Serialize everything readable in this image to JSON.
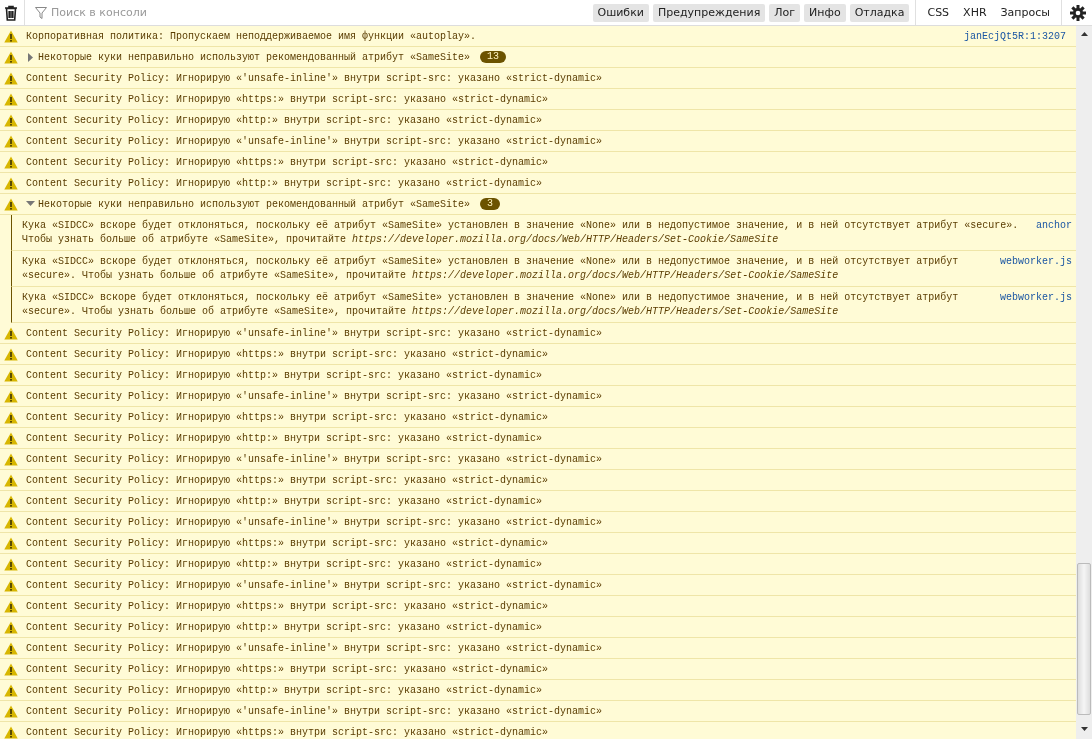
{
  "toolbar": {
    "search": {
      "placeholder": "Поиск в консоли"
    },
    "filters": [
      {
        "label": "Ошибки",
        "selected": true
      },
      {
        "label": "Предупреждения",
        "selected": true
      },
      {
        "label": "Лог",
        "selected": true
      },
      {
        "label": "Инфо",
        "selected": true
      },
      {
        "label": "Отладка",
        "selected": true
      }
    ],
    "request_filters": [
      {
        "label": "CSS",
        "selected": false
      },
      {
        "label": "XHR",
        "selected": false
      },
      {
        "label": "Запросы",
        "selected": false
      }
    ]
  },
  "messages": [
    {
      "kind": "warning",
      "text": "Корпоративная политика: Пропускаем неподдерживаемое имя функции «autoplay».",
      "source": "janEcjQt5R:1:3207"
    },
    {
      "kind": "group",
      "text": "Некоторые куки неправильно используют рекомендованный атрибут «SameSite»",
      "count": "13",
      "expanded": false
    },
    {
      "kind": "warning",
      "text": "Content Security Policy: Игнорирую «'unsafe-inline'» внутри script-src: указано «strict-dynamic»"
    },
    {
      "kind": "warning",
      "text": "Content Security Policy: Игнорирую «https:» внутри script-src: указано «strict-dynamic»"
    },
    {
      "kind": "warning",
      "text": "Content Security Policy: Игнорирую «http:» внутри script-src: указано «strict-dynamic»"
    },
    {
      "kind": "warning",
      "text": "Content Security Policy: Игнорирую «'unsafe-inline'» внутри script-src: указано «strict-dynamic»"
    },
    {
      "kind": "warning",
      "text": "Content Security Policy: Игнорирую «https:» внутри script-src: указано «strict-dynamic»"
    },
    {
      "kind": "warning",
      "text": "Content Security Policy: Игнорирую «http:» внутри script-src: указано «strict-dynamic»"
    },
    {
      "kind": "group",
      "text": "Некоторые куки неправильно используют рекомендованный атрибут «SameSite»",
      "count": "3",
      "expanded": true,
      "children": [
        {
          "text": "Кука «SIDCC» вскоре будет отклоняться, поскольку её атрибут «SameSite» установлен в значение «None» или в недопустимое значение, и в ней отсутствует атрибут «secure». Чтобы узнать больше об атрибуте «SameSite», прочитайте *https://developer.mozilla.org/docs/Web/HTTP/Headers/Set-Cookie/SameSite*",
          "source": "anchor"
        },
        {
          "text": "Кука «SIDCC» вскоре будет отклоняться, поскольку её атрибут «SameSite» установлен в значение «None» или в недопустимое значение, и в ней отсутствует атрибут «secure». Чтобы узнать больше об атрибуте «SameSite», прочитайте *https://developer.mozilla.org/docs/Web/HTTP/Headers/Set-Cookie/SameSite*",
          "source": "webworker.js"
        },
        {
          "text": "Кука «SIDCC» вскоре будет отклоняться, поскольку её атрибут «SameSite» установлен в значение «None» или в недопустимое значение, и в ней отсутствует атрибут «secure». Чтобы узнать больше об атрибуте «SameSite», прочитайте *https://developer.mozilla.org/docs/Web/HTTP/Headers/Set-Cookie/SameSite*",
          "source": "webworker.js"
        }
      ]
    },
    {
      "kind": "warning",
      "text": "Content Security Policy: Игнорирую «'unsafe-inline'» внутри script-src: указано «strict-dynamic»"
    },
    {
      "kind": "warning",
      "text": "Content Security Policy: Игнорирую «https:» внутри script-src: указано «strict-dynamic»"
    },
    {
      "kind": "warning",
      "text": "Content Security Policy: Игнорирую «http:» внутри script-src: указано «strict-dynamic»"
    },
    {
      "kind": "warning",
      "text": "Content Security Policy: Игнорирую «'unsafe-inline'» внутри script-src: указано «strict-dynamic»"
    },
    {
      "kind": "warning",
      "text": "Content Security Policy: Игнорирую «https:» внутри script-src: указано «strict-dynamic»"
    },
    {
      "kind": "warning",
      "text": "Content Security Policy: Игнорирую «http:» внутри script-src: указано «strict-dynamic»"
    },
    {
      "kind": "warning",
      "text": "Content Security Policy: Игнорирую «'unsafe-inline'» внутри script-src: указано «strict-dynamic»"
    },
    {
      "kind": "warning",
      "text": "Content Security Policy: Игнорирую «https:» внутри script-src: указано «strict-dynamic»"
    },
    {
      "kind": "warning",
      "text": "Content Security Policy: Игнорирую «http:» внутри script-src: указано «strict-dynamic»"
    },
    {
      "kind": "warning",
      "text": "Content Security Policy: Игнорирую «'unsafe-inline'» внутри script-src: указано «strict-dynamic»"
    },
    {
      "kind": "warning",
      "text": "Content Security Policy: Игнорирую «https:» внутри script-src: указано «strict-dynamic»"
    },
    {
      "kind": "warning",
      "text": "Content Security Policy: Игнорирую «http:» внутри script-src: указано «strict-dynamic»"
    },
    {
      "kind": "warning",
      "text": "Content Security Policy: Игнорирую «'unsafe-inline'» внутри script-src: указано «strict-dynamic»"
    },
    {
      "kind": "warning",
      "text": "Content Security Policy: Игнорирую «https:» внутри script-src: указано «strict-dynamic»"
    },
    {
      "kind": "warning",
      "text": "Content Security Policy: Игнорирую «http:» внутри script-src: указано «strict-dynamic»"
    },
    {
      "kind": "warning",
      "text": "Content Security Policy: Игнорирую «'unsafe-inline'» внутри script-src: указано «strict-dynamic»"
    },
    {
      "kind": "warning",
      "text": "Content Security Policy: Игнорирую «https:» внутри script-src: указано «strict-dynamic»"
    },
    {
      "kind": "warning",
      "text": "Content Security Policy: Игнорирую «http:» внутри script-src: указано «strict-dynamic»"
    },
    {
      "kind": "warning",
      "text": "Content Security Policy: Игнорирую «'unsafe-inline'» внутри script-src: указано «strict-dynamic»"
    },
    {
      "kind": "warning",
      "text": "Content Security Policy: Игнорирую «https:» внутри script-src: указано «strict-dynamic»"
    }
  ]
}
